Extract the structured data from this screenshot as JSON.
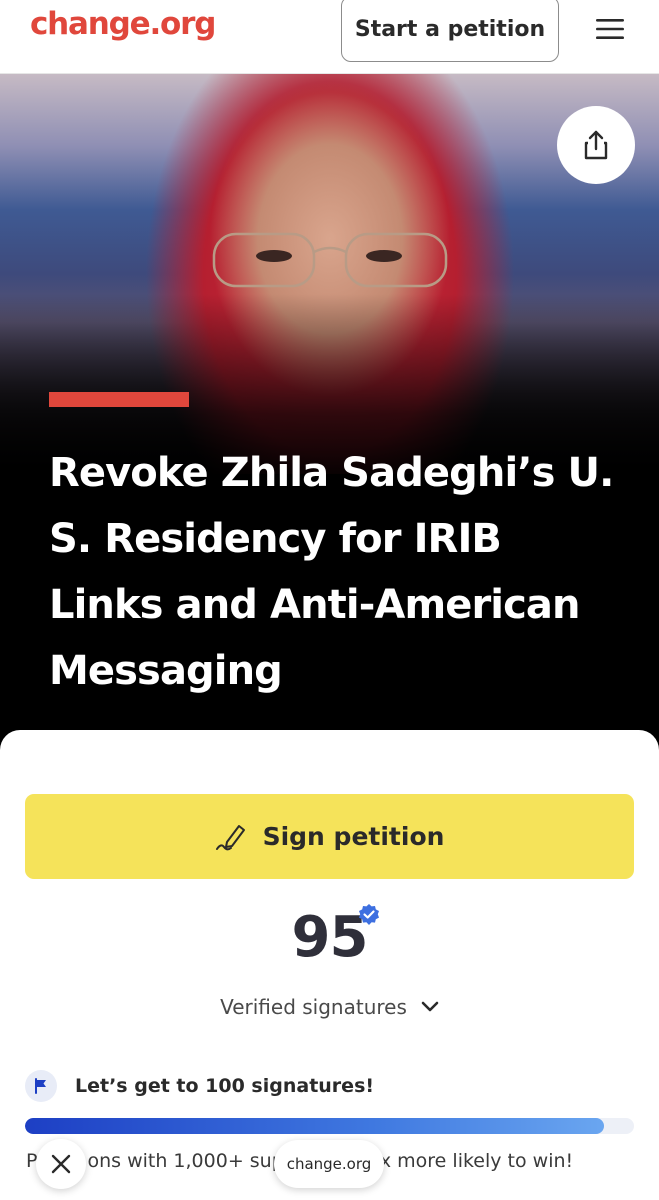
{
  "header": {
    "logo": "change.org",
    "start_petition_label": "Start a petition",
    "menu_icon": "hamburger-icon"
  },
  "hero": {
    "share_icon": "share-icon",
    "title": "Revoke Zhila Sadeghi’s U. S. Residency for IRIB Links and Anti-American Messaging",
    "accent_color": "#e0473c"
  },
  "signature_card": {
    "sign_label": "Sign petition",
    "sign_icon": "pen-signature-icon",
    "sign_color": "#f5e35a",
    "count": "95",
    "verified_icon": "verified-badge-icon",
    "verified_label": "Verified signatures",
    "expand_icon": "chevron-down-icon",
    "goal_icon": "flag-icon",
    "goal_text": "Let’s get to 100 signatures!",
    "progress_fraction": 0.95,
    "info_visible_start": "P",
    "info_visible_mid": "ons with 1,000+ sup",
    "info_visible_end": "5x more likely to win!"
  },
  "browser_overlay": {
    "close_icon": "close-icon",
    "url": "change.org"
  }
}
